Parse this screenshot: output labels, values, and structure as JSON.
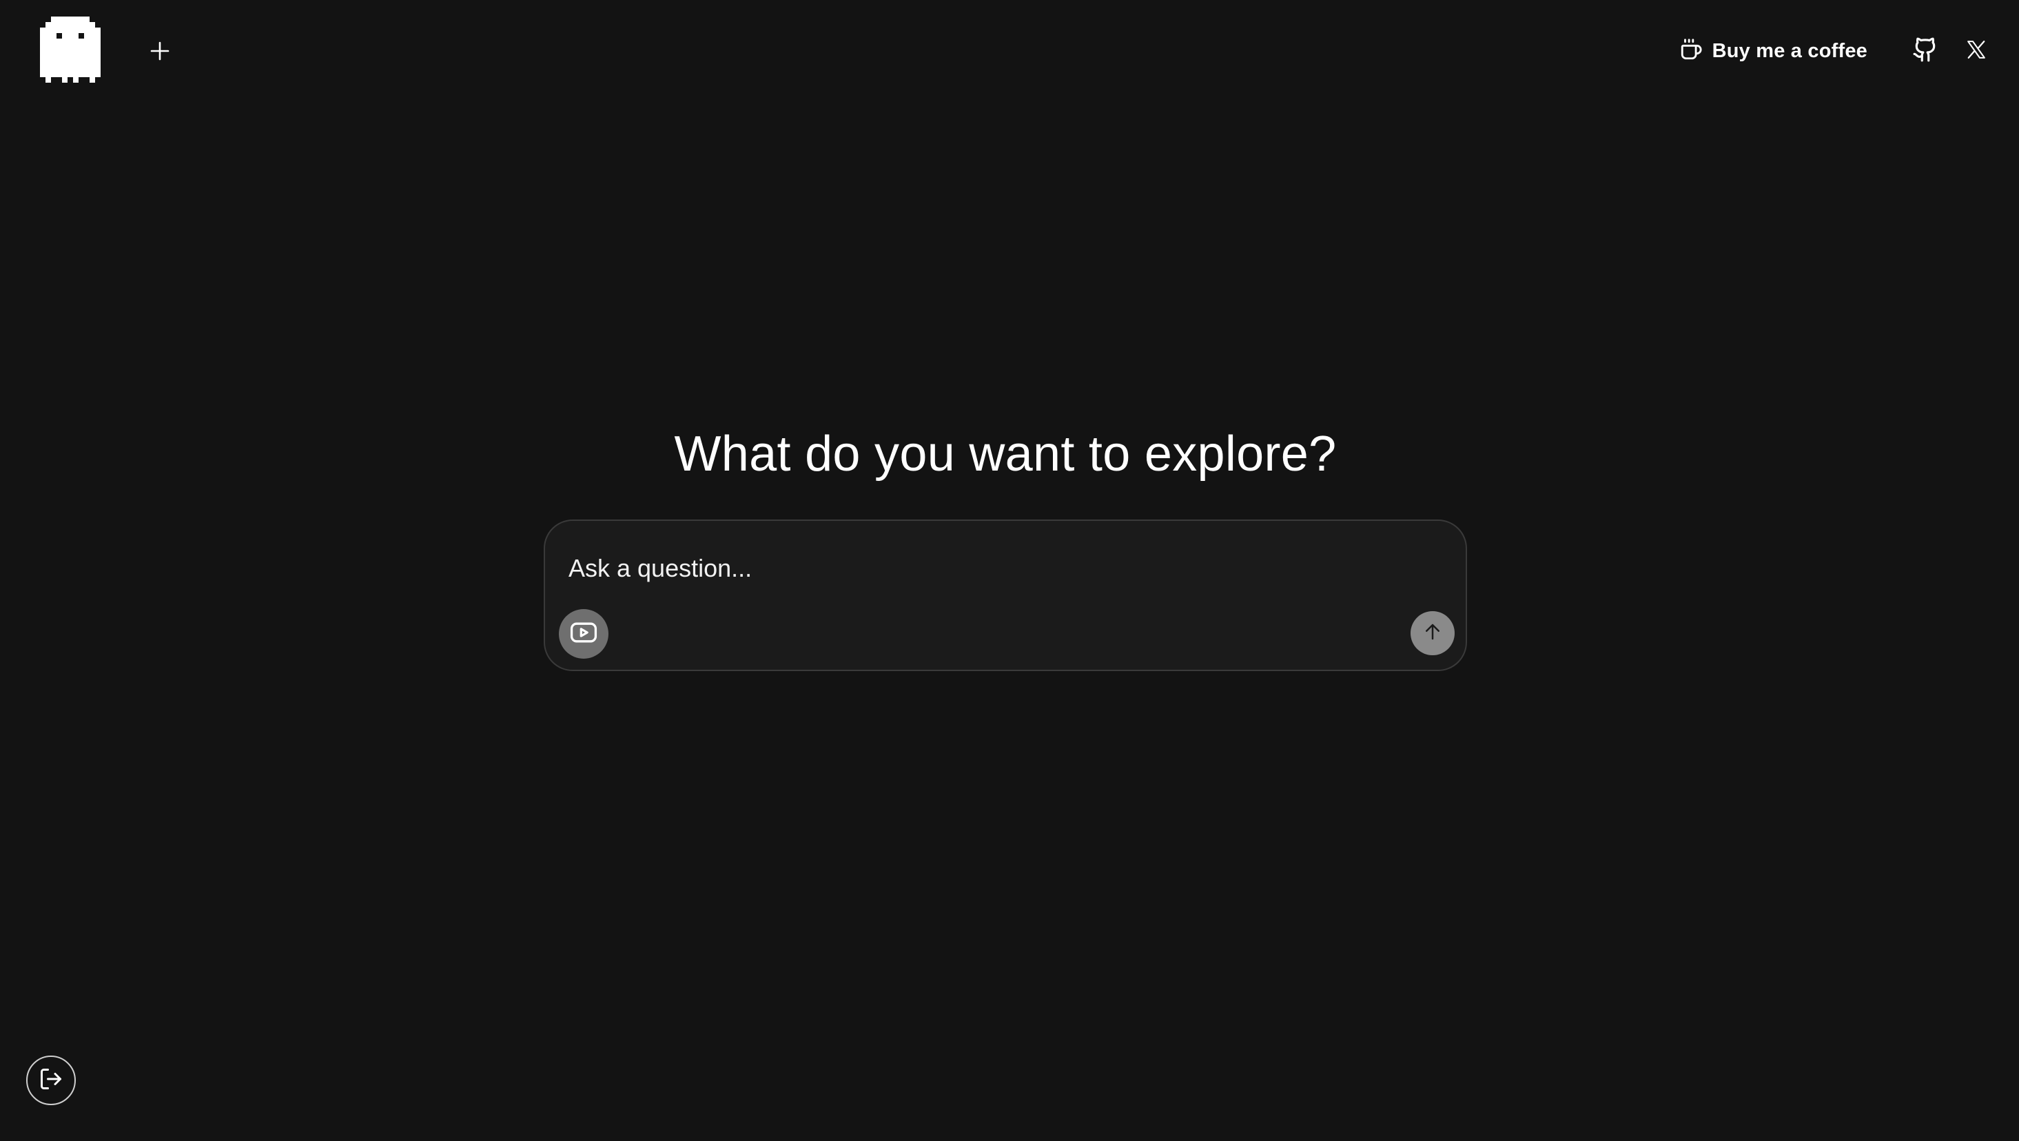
{
  "header": {
    "logo_icon": "pixel-ghost-icon",
    "new_chat_icon": "plus-icon",
    "coffee": {
      "icon": "coffee-cup-icon",
      "label": "Buy me a coffee"
    },
    "github_icon": "github-icon",
    "x_icon": "x-logo-icon"
  },
  "main": {
    "headline": "What do you want to explore?",
    "composer": {
      "placeholder": "Ask a question...",
      "video_button_icon": "youtube-play-icon",
      "send_button_icon": "arrow-up-icon"
    }
  },
  "footer": {
    "logout_icon": "logout-icon"
  },
  "colors": {
    "background": "#131313",
    "composer_background": "#1b1b1b",
    "composer_border": "#3a3a3a",
    "video_button": "#6f6f6f",
    "send_button": "#8a8a8a",
    "text": "#ffffff"
  }
}
